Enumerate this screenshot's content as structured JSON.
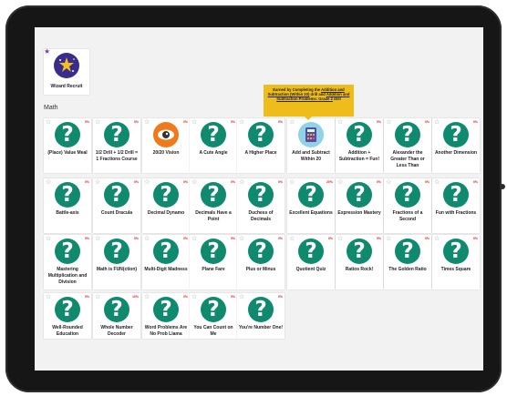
{
  "wizard": {
    "name": "Wizard Recruit"
  },
  "section_title": "Math",
  "tooltip": {
    "pre": "Earned by Completing the ",
    "link1": "Addition and Subtraction (Within 20)",
    "mid": " drill and ",
    "link2": "Addition and Subtraction Problems: Grade 2",
    "post": " drill"
  },
  "badges": [
    {
      "name": "(Place) Value Meal",
      "pct": "0%"
    },
    {
      "name": "1/2 Drill + 1/2 Drill = 1 Fractions Course",
      "pct": "0%"
    },
    {
      "name": "20/20 Vision",
      "pct": "0%",
      "icon": "eye-icon"
    },
    {
      "name": "A Cute Angle",
      "pct": "0%"
    },
    {
      "name": "A Higher Place",
      "pct": "0%"
    },
    {
      "name": "Add and Subtract Within 20",
      "pct": "",
      "icon": "calculator-icon"
    },
    {
      "name": "Addition + Subtraction = Fun!",
      "pct": "0%"
    },
    {
      "name": "Alexander the Greater Than or Less Than",
      "pct": "0%"
    },
    {
      "name": "Another Dimension",
      "pct": "0%"
    },
    {
      "name": "Battle-axis",
      "pct": "0%"
    },
    {
      "name": "Count Dracula",
      "pct": "0%"
    },
    {
      "name": "Decimal Dynamo",
      "pct": "0%"
    },
    {
      "name": "Decimals Have a Point",
      "pct": "0%"
    },
    {
      "name": "Duchess of Decimals",
      "pct": "0%"
    },
    {
      "name": "Excellent Equations",
      "pct": "20%"
    },
    {
      "name": "Expression Mastery",
      "pct": "0%"
    },
    {
      "name": "Fractions of a Second",
      "pct": "0%"
    },
    {
      "name": "Fun with Fractions",
      "pct": "0%"
    },
    {
      "name": "Mastering Multiplication and Division",
      "pct": "0%"
    },
    {
      "name": "Math is FUN(ction)",
      "pct": "0%"
    },
    {
      "name": "Multi-Digit Madness",
      "pct": "0%"
    },
    {
      "name": "Plane Fare",
      "pct": "0%"
    },
    {
      "name": "Plus or Minus",
      "pct": "0%"
    },
    {
      "name": "Quotient Quiz",
      "pct": "0%"
    },
    {
      "name": "Ratios Rock!",
      "pct": "0%"
    },
    {
      "name": "The Golden Ratio",
      "pct": "0%"
    },
    {
      "name": "Times Square",
      "pct": "0%"
    },
    {
      "name": "Well-Rounded Education",
      "pct": "0%"
    },
    {
      "name": "Whole Number Decoder",
      "pct": "10%"
    },
    {
      "name": "Word Problems Are No Prob Llama",
      "pct": "0%"
    },
    {
      "name": "You Can Count on Me",
      "pct": "0%"
    },
    {
      "name": "You're Number One!",
      "pct": "0%"
    }
  ]
}
